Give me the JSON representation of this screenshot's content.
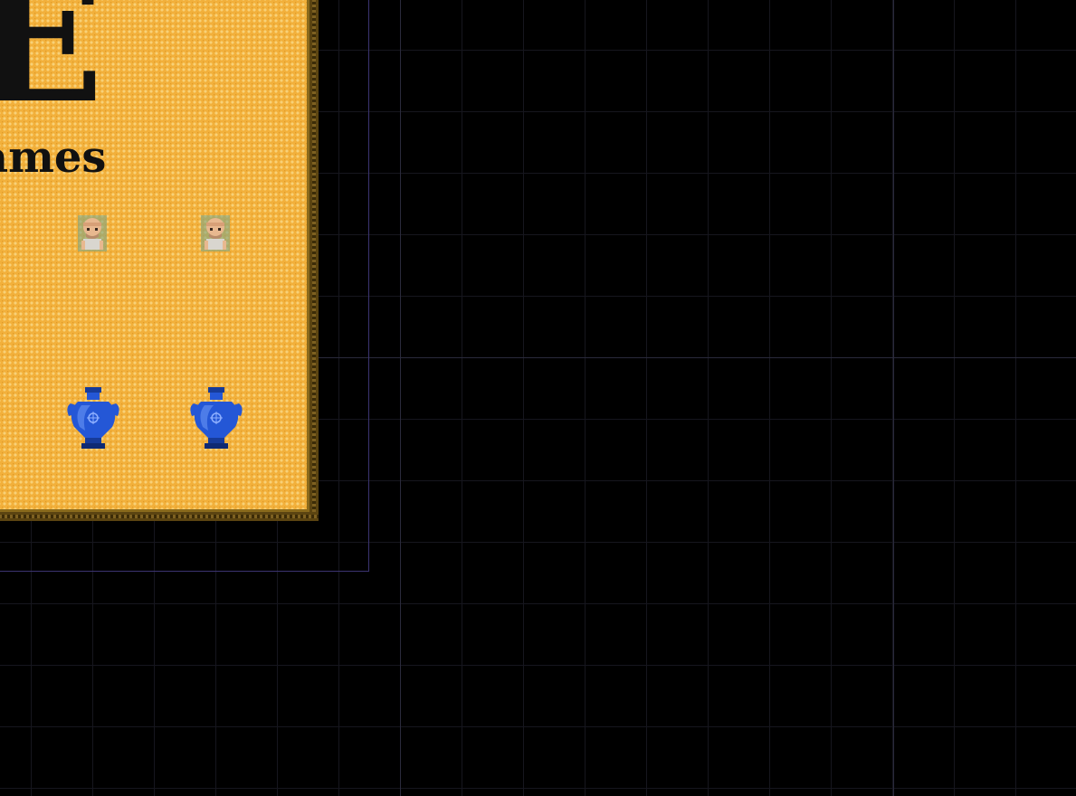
{
  "editor": {
    "background_color": "#000000",
    "grid_color": "#16161e",
    "room_bound_color": "#3b3470"
  },
  "board": {
    "fill_color": "#f2b03b",
    "border_color": "#5b4411",
    "title_text": "E",
    "subtitle_text": "ames"
  },
  "sprites": {
    "characters": [
      {
        "name": "character-sprite-1",
        "icon": "bald-man-portrait-icon"
      },
      {
        "name": "character-sprite-2",
        "icon": "bald-man-portrait-icon"
      }
    ],
    "vases": [
      {
        "name": "vase-sprite-1",
        "icon": "blue-amphora-icon",
        "color": "#1f4fc4"
      },
      {
        "name": "vase-sprite-2",
        "icon": "blue-amphora-icon",
        "color": "#1f4fc4"
      }
    ]
  }
}
